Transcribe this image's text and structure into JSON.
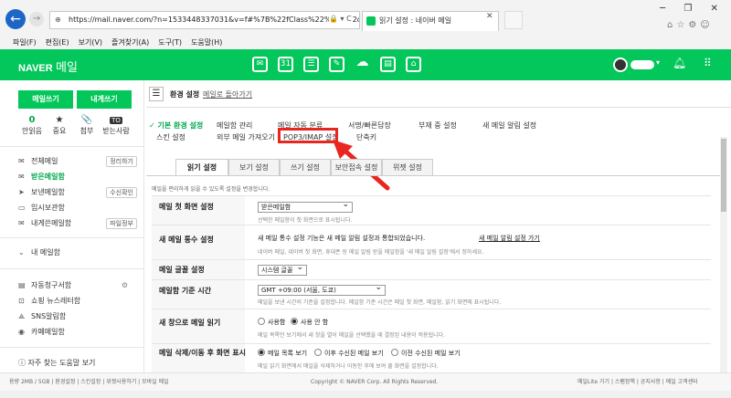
{
  "browser": {
    "url": "https://mail.naver.com/?n=1533448337031&v=f#%7B%22fClass%22%3A%22option%22%2C",
    "addr_icons": "🔒 ▾ C",
    "tab_title": "읽기 설정 : 네이버 메일",
    "menu": [
      "파일(F)",
      "편집(E)",
      "보기(V)",
      "즐겨찾기(A)",
      "도구(T)",
      "도움말(H)"
    ],
    "win_controls": [
      "─",
      "❐",
      "✕"
    ]
  },
  "header": {
    "logo": "NAVER",
    "logo_sub": "메일"
  },
  "sidebar": {
    "write": "메일쓰기",
    "to_me": "내게쓰기",
    "stats": [
      {
        "value": "0",
        "label": "안읽음"
      },
      {
        "icon": "★",
        "label": "중요"
      },
      {
        "icon": "📎",
        "label": "첨부"
      },
      {
        "badge": "TO",
        "label": "받는사람"
      }
    ],
    "folders": [
      {
        "label": "전체메일",
        "pill": "정리하기"
      },
      {
        "label": "받은메일함",
        "pill": ""
      },
      {
        "label": "보낸메일함",
        "pill": "수신확인"
      },
      {
        "label": "임시보관함",
        "pill": ""
      },
      {
        "label": "내게쓴메일함",
        "pill": "파일정부"
      }
    ],
    "my_mailbox": "내 메일함",
    "extra": [
      {
        "label": "자동청구서함"
      },
      {
        "label": "쇼핑 뉴스레터함"
      },
      {
        "label": "SNS알림함"
      },
      {
        "label": "카페메일함"
      }
    ],
    "faq": "자주 찾는 도움말 보기"
  },
  "main": {
    "title": "환경 설정",
    "back_link": "메일로 돌아가기",
    "links": {
      "basic": "기본 환경 설정",
      "mailbox": "메일함 관리",
      "auto_class": "메일 자동 분류",
      "signature": "서명/빠른답장",
      "absence": "부재 중 설정",
      "alert": "새 메일 알림 설정",
      "skin": "스킨 설정",
      "external": "외부 메일 가져오기",
      "pop3": "POP3/IMAP 설정",
      "shortcut": "단축키"
    },
    "tabs": [
      "읽기 설정",
      "보기 설정",
      "쓰기 설정",
      "보안접속 설정",
      "위젯 설정"
    ],
    "desc": "메일을 편리하게 읽을 수 있도록 설정을 변경합니다.",
    "rows": {
      "first_screen": {
        "label": "메일 첫 화면 설정",
        "select": "받은메일함",
        "note": "선택한 메일함이 첫 화면으로 표시됩니다."
      },
      "new_count": {
        "label": "새 메일 통수 설정",
        "text": "새 메일 통수 설정 기능은 새 메일 알림 설정과 통합되었습니다.",
        "link": "새 메일 알림 설정 가기",
        "note": "네이버 메일, 네이버 첫 화면, 휴대폰 등 메일 알림 받을 메일함을 '새 메일 알림 설정'에서 정하세요."
      },
      "font": {
        "label": "메일 글꼴 설정",
        "select": "시스템 글꼴"
      },
      "timezone": {
        "label": "메일함 기준 시간",
        "select": "GMT +09:00 (서울, 도쿄)",
        "note": "메일을 보낸 시간의 기준을 설정합니다. 메일함 기준 시간은 메일 첫 화면, 메일함, 읽기 화면에 표시됩니다."
      },
      "new_window": {
        "label": "새 창으로 메일 읽기",
        "opt1": "사용함",
        "opt2": "사용 안 함",
        "note": "메일 목록만 보기에서 새 창을 열어 메일을 선택했을 때 결정된 내용이 적용됩니다."
      },
      "after_delete": {
        "label": "메일 삭제/이동 후 화면 표시",
        "opt1": "메일 목록 보기",
        "opt2": "이후 수신된 메일 보기",
        "opt3": "이전 수신된 메일 보기",
        "note": "메일 읽기 화면에서 메일을 삭제하거나 이동한 후에 보여 줄 화면을 설정합니다."
      }
    }
  },
  "footer": {
    "left": "용량 2MB / 5GB | 환경설정 | 스킨설정 | 위젯사용하기 | 모바일 메일",
    "center": "Copyright © NAVER Corp. All Rights Reserved.",
    "right": "메일Lite 가기 | 스팸정책 | 공지사항 | 메일 고객센터"
  }
}
